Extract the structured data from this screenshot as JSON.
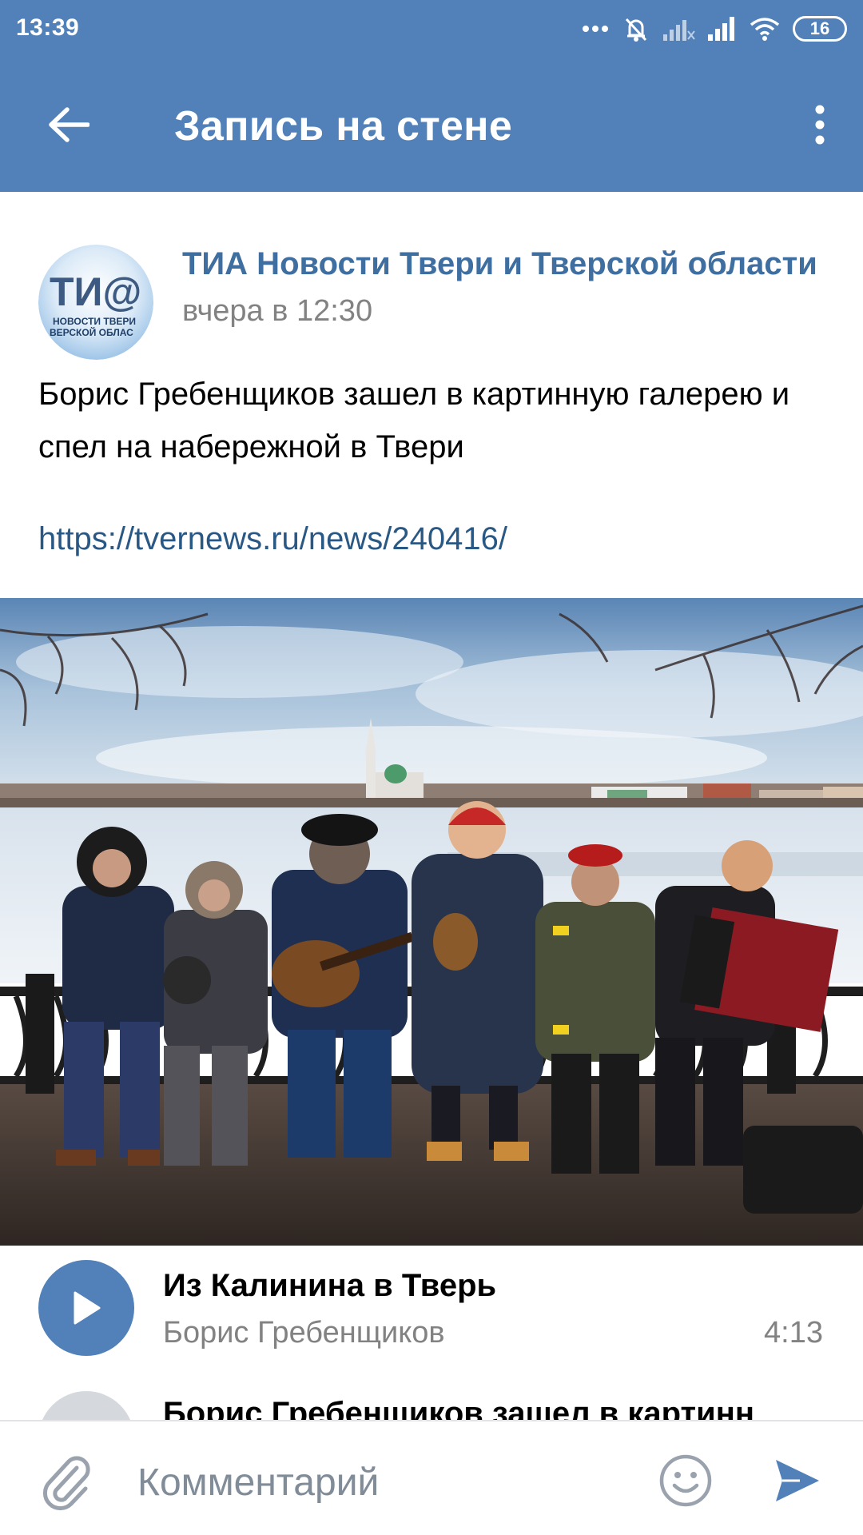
{
  "status_bar": {
    "time": "13:39",
    "battery": "16",
    "icons": [
      "dots-icon",
      "mute-icon",
      "signal-weak-icon",
      "signal-icon",
      "wifi-icon",
      "battery-icon"
    ]
  },
  "app_bar": {
    "title": "Запись на стене",
    "icons": [
      "back-arrow-icon",
      "more-vertical-icon"
    ]
  },
  "post": {
    "author": "ТИА Новости Твери и Тверской области",
    "date": "вчера в 12:30",
    "avatar": {
      "logo_text": "ТИ@",
      "caption_line1": "НОВОСТИ ТВЕРИ",
      "caption_line2": "ВЕРСКОЙ ОБЛАС"
    },
    "text": "Борис Гребенщиков зашел в картинную галерею и спел на набережной в Твери",
    "link": "https://tvernews.ru/news/240416/"
  },
  "audio": {
    "title": "Из Калинина в Тверь",
    "artist": "Борис Гребенщиков",
    "duration": "4:13",
    "icon": "play-icon"
  },
  "next_item": {
    "title": "Борис Гребенщиков зашел в картинн"
  },
  "comment_bar": {
    "placeholder": "Комментарий",
    "icons": [
      "paperclip-icon",
      "smile-icon",
      "send-icon"
    ]
  },
  "colors": {
    "header": "#5181b8",
    "link": "#2a5885",
    "author": "#3f6fa0",
    "secondary_text": "#828282"
  }
}
